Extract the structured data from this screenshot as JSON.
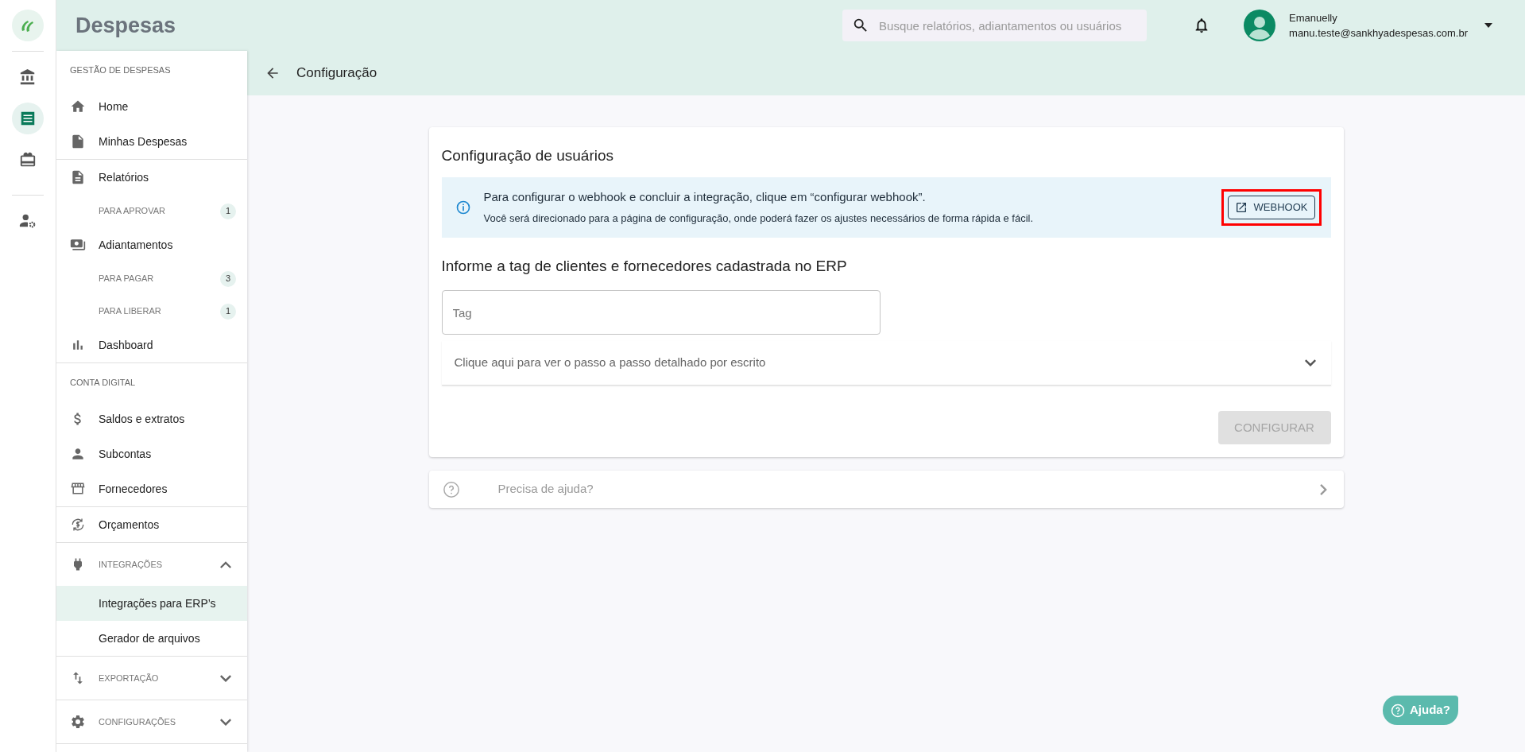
{
  "rail": {
    "groups": [
      [
        {
          "selected": false
        },
        {
          "selected": true
        },
        {
          "selected": false
        }
      ],
      [
        {
          "selected": false
        }
      ]
    ]
  },
  "header": {
    "title": "Despesas",
    "search": {
      "placeholder": "Busque relatórios, adiantamentos ou usuários"
    },
    "user": {
      "name": "Emanuelly",
      "email": "manu.teste@sankhyadespesas.com.br"
    }
  },
  "sidebar": {
    "blocks": [
      [
        {
          "kind": "heading",
          "label": "GESTÃO DE DESPESAS"
        },
        {
          "kind": "link",
          "label": "Home",
          "selected": false
        },
        {
          "kind": "link",
          "label": "Minhas Despesas",
          "selected": false
        }
      ],
      [
        {
          "kind": "link",
          "label": "Relatórios",
          "selected": false
        },
        {
          "kind": "sublink",
          "label": "PARA APROVAR",
          "badge": "1"
        },
        {
          "kind": "link",
          "label": "Adiantamentos",
          "selected": false
        },
        {
          "kind": "sublink",
          "label": "PARA PAGAR",
          "badge": "3"
        },
        {
          "kind": "sublink",
          "label": "PARA LIBERAR",
          "badge": "1"
        },
        {
          "kind": "link",
          "label": "Dashboard",
          "selected": false
        }
      ],
      [
        {
          "kind": "heading",
          "label": "CONTA DIGITAL"
        },
        {
          "kind": "link",
          "label": "Saldos e extratos",
          "selected": false
        },
        {
          "kind": "link",
          "label": "Subcontas",
          "selected": false
        },
        {
          "kind": "link",
          "label": "Fornecedores",
          "selected": false
        }
      ],
      [
        {
          "kind": "link",
          "label": "Orçamentos",
          "selected": false
        }
      ],
      [
        {
          "kind": "group",
          "label": "INTEGRAÇÕES",
          "expanded": true,
          "children": [
            {
              "label": "Integrações para ERP’s",
              "selected": true
            },
            {
              "label": "Gerador de arquivos",
              "selected": false
            }
          ]
        }
      ],
      [
        {
          "kind": "group",
          "label": "EXPORTAÇÃO",
          "expanded": false
        }
      ],
      [
        {
          "kind": "group",
          "label": "CONFIGURAÇÕES",
          "expanded": false
        }
      ]
    ]
  },
  "page": {
    "title": "Configuração"
  },
  "card": {
    "title": "Configuração de usuários",
    "alert": {
      "text": "Para configurar o webhook e concluir a integração, clique em “configurar webhook”.",
      "detail": "Você será direcionado para a página de configuração, onde poderá fazer os ajustes necessários de forma rápida e fácil.",
      "button": {
        "label": "WEBHOOK",
        "highlighted": true
      }
    },
    "tag_prompt": "Informe a tag de clientes e fornecedores cadastrada no ERP",
    "tag_field": {
      "placeholder": "Tag"
    },
    "steps": {
      "label": "Clique aqui para ver o passo a passo detalhado por escrito",
      "expanded": false
    },
    "configure_button": {
      "label": "CONFIGURAR",
      "disabled": true
    }
  },
  "help_card": {
    "label": "Precisa de ajuda?"
  },
  "help_button": {
    "label": "Ajuda?"
  }
}
